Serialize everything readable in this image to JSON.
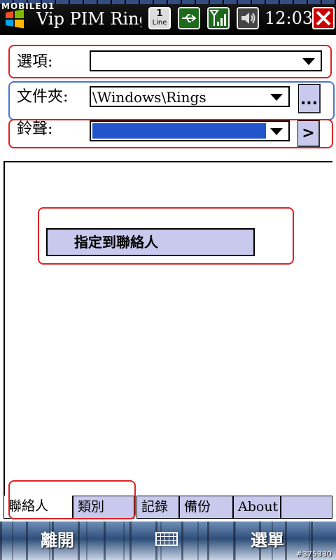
{
  "status_bar": {
    "watermark": "MOBILE01",
    "app_title": "Vip PIM Ringto",
    "line_number": "1",
    "line_label": "Line",
    "time": "12:03"
  },
  "form": {
    "options_label": "選項:",
    "options_value": "",
    "folder_label": "文件夾:",
    "folder_value": "\\Windows\\Rings",
    "folder_browse_label": "...",
    "ringtone_label": "鈴聲:",
    "ringtone_value": "",
    "ringtone_next_label": ">"
  },
  "content": {
    "assign_button_label": "指定到聯絡人"
  },
  "tabs": [
    {
      "label": "聯絡人",
      "active": true
    },
    {
      "label": "類別",
      "active": false
    },
    {
      "label": "記錄",
      "active": false
    },
    {
      "label": "備份",
      "active": false
    },
    {
      "label": "About",
      "active": false
    }
  ],
  "softkeys": {
    "left": "離開",
    "right": "選單"
  },
  "image_tag": "#375330",
  "colors": {
    "selection": "#2255cc",
    "button_face": "#c9c9ee",
    "annotation_red": "#d22222",
    "annotation_blue": "#4a74d4"
  },
  "icons": [
    "windows-start-icon",
    "line-icon",
    "usb-icon",
    "signal-icon",
    "speaker-icon",
    "close-icon",
    "keyboard-icon"
  ]
}
